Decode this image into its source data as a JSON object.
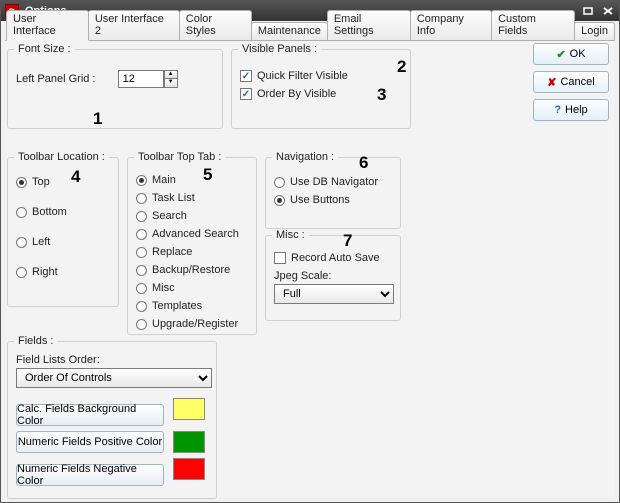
{
  "window": {
    "title": "Options"
  },
  "tabs": [
    "User Interface",
    "User Interface 2",
    "Color Styles",
    "Maintenance",
    "Email Settings",
    "Company Info",
    "Custom Fields",
    "Login"
  ],
  "active_tab": 0,
  "buttons": {
    "ok": "OK",
    "cancel": "Cancel",
    "help": "Help"
  },
  "fontsize": {
    "legend": "Font Size :",
    "label": "Left Panel Grid :",
    "value": "12"
  },
  "visible_panels": {
    "legend": "Visible Panels :",
    "quick_filter": {
      "label": "Quick Filter Visible",
      "checked": true
    },
    "order_by": {
      "label": "Order By Visible",
      "checked": true
    }
  },
  "toolbar_location": {
    "legend": "Toolbar Location :",
    "options": [
      "Top",
      "Bottom",
      "Left",
      "Right"
    ],
    "selected": 0
  },
  "toolbar_top_tab": {
    "legend": "Toolbar Top Tab :",
    "options": [
      "Main",
      "Task List",
      "Search",
      "Advanced Search",
      "Replace",
      "Backup/Restore",
      "Misc",
      "Templates",
      "Upgrade/Register"
    ],
    "selected": 0
  },
  "navigation": {
    "legend": "Navigation :",
    "options": [
      "Use DB Navigator",
      "Use Buttons"
    ],
    "selected": 1
  },
  "misc": {
    "legend": "Misc :",
    "record_auto_save": {
      "label": "Record Auto Save",
      "checked": false
    },
    "jpeg_scale_label": "Jpeg Scale:",
    "jpeg_scale_value": "Full"
  },
  "fields": {
    "legend": "Fields :",
    "order_label": "Field Lists Order:",
    "order_value": "Order Of Controls",
    "calc_bg_label": "Calc. Fields Background Color",
    "calc_bg_color": "#FFFF66",
    "num_pos_label": "Numeric Fields Positive Color",
    "num_pos_color": "#009400",
    "num_neg_label": "Numeric Fields Negative Color",
    "num_neg_color": "#FF0000"
  },
  "annotations": [
    "1",
    "2",
    "3",
    "4",
    "5",
    "6",
    "7"
  ]
}
